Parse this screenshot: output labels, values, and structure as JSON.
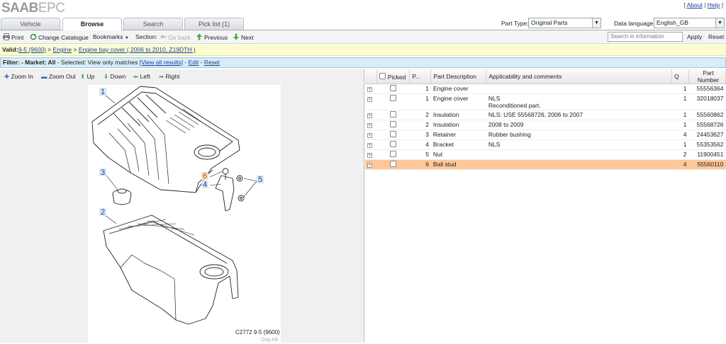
{
  "app": {
    "logo_main": "SAAB",
    "logo_sub": "EPC"
  },
  "toplinks": {
    "about": "About",
    "help": "Help"
  },
  "tabs": [
    {
      "label": "Vehicle",
      "active": false
    },
    {
      "label": "Browse",
      "active": true
    },
    {
      "label": "Search",
      "active": false
    },
    {
      "label": "Pick list (1)",
      "active": false
    }
  ],
  "part_type": {
    "label": "Part Type:",
    "value": "Original Parts"
  },
  "data_language": {
    "label": "Data language:",
    "value": "English_GB"
  },
  "toolbar": {
    "print": "Print",
    "change_catalogue": "Change Catalogue",
    "bookmarks": "Bookmarks",
    "section": "Section:",
    "go_back": "Go back",
    "previous": "Previous",
    "next": "Next",
    "search_placeholder": "Search in information",
    "apply": "Apply",
    "reset": "Reset"
  },
  "valid": {
    "prefix": "Valid:",
    "model": "9-5 (9600)",
    "sep": ">",
    "group": "Engine",
    "section": "Engine bay cover ( 2006 to 2010, Z19DTH )"
  },
  "filter": {
    "text1": "Filter: - Market: ",
    "market": "All",
    "text2": " - Selected: View only matches ",
    "view_all": "[View all results]",
    "edit": "Edit",
    "reset": "Reset"
  },
  "zoombar": {
    "zoom_in": "Zoom In",
    "zoom_out": "Zoom Out",
    "up": "Up",
    "down": "Down",
    "left": "Left",
    "right": "Right"
  },
  "diagram": {
    "caption": "C2772 9-5 (9600)",
    "sub_caption": "Orig AB",
    "callouts": [
      "1",
      "2",
      "3",
      "4",
      "5",
      "6"
    ]
  },
  "table": {
    "headers": [
      "Picked",
      "P...",
      "Part Description",
      "Applicability and comments",
      "Q",
      "Part Number"
    ],
    "rows": [
      {
        "pos": "1",
        "desc": "Engine cover",
        "comment": "",
        "comment2": "",
        "qty": "1",
        "part": "55556364",
        "selected": false
      },
      {
        "pos": "1",
        "desc": "Engine cover",
        "comment": "NLS",
        "comment2": "Reconditioned part.",
        "qty": "1",
        "part": "32018037",
        "selected": false
      },
      {
        "pos": "2",
        "desc": "Insulation",
        "comment": "NLS: USE 55568726, 2006 to 2007",
        "comment2": "",
        "qty": "1",
        "part": "55560862",
        "selected": false
      },
      {
        "pos": "2",
        "desc": "Insulation",
        "comment": "2008 to 2009",
        "comment2": "",
        "qty": "1",
        "part": "55568726",
        "selected": false
      },
      {
        "pos": "3",
        "desc": "Retainer",
        "comment": "Rubber bushing",
        "comment2": "",
        "qty": "4",
        "part": "24453627",
        "selected": false
      },
      {
        "pos": "4",
        "desc": "Bracket",
        "comment": "NLS",
        "comment2": "",
        "qty": "1",
        "part": "55353562",
        "selected": false
      },
      {
        "pos": "5",
        "desc": "Nut",
        "comment": "",
        "comment2": "",
        "qty": "2",
        "part": "11900451",
        "selected": false
      },
      {
        "pos": "6",
        "desc": "Ball stud",
        "comment": "",
        "comment2": "",
        "qty": "4",
        "part": "55560110",
        "selected": true
      }
    ]
  }
}
